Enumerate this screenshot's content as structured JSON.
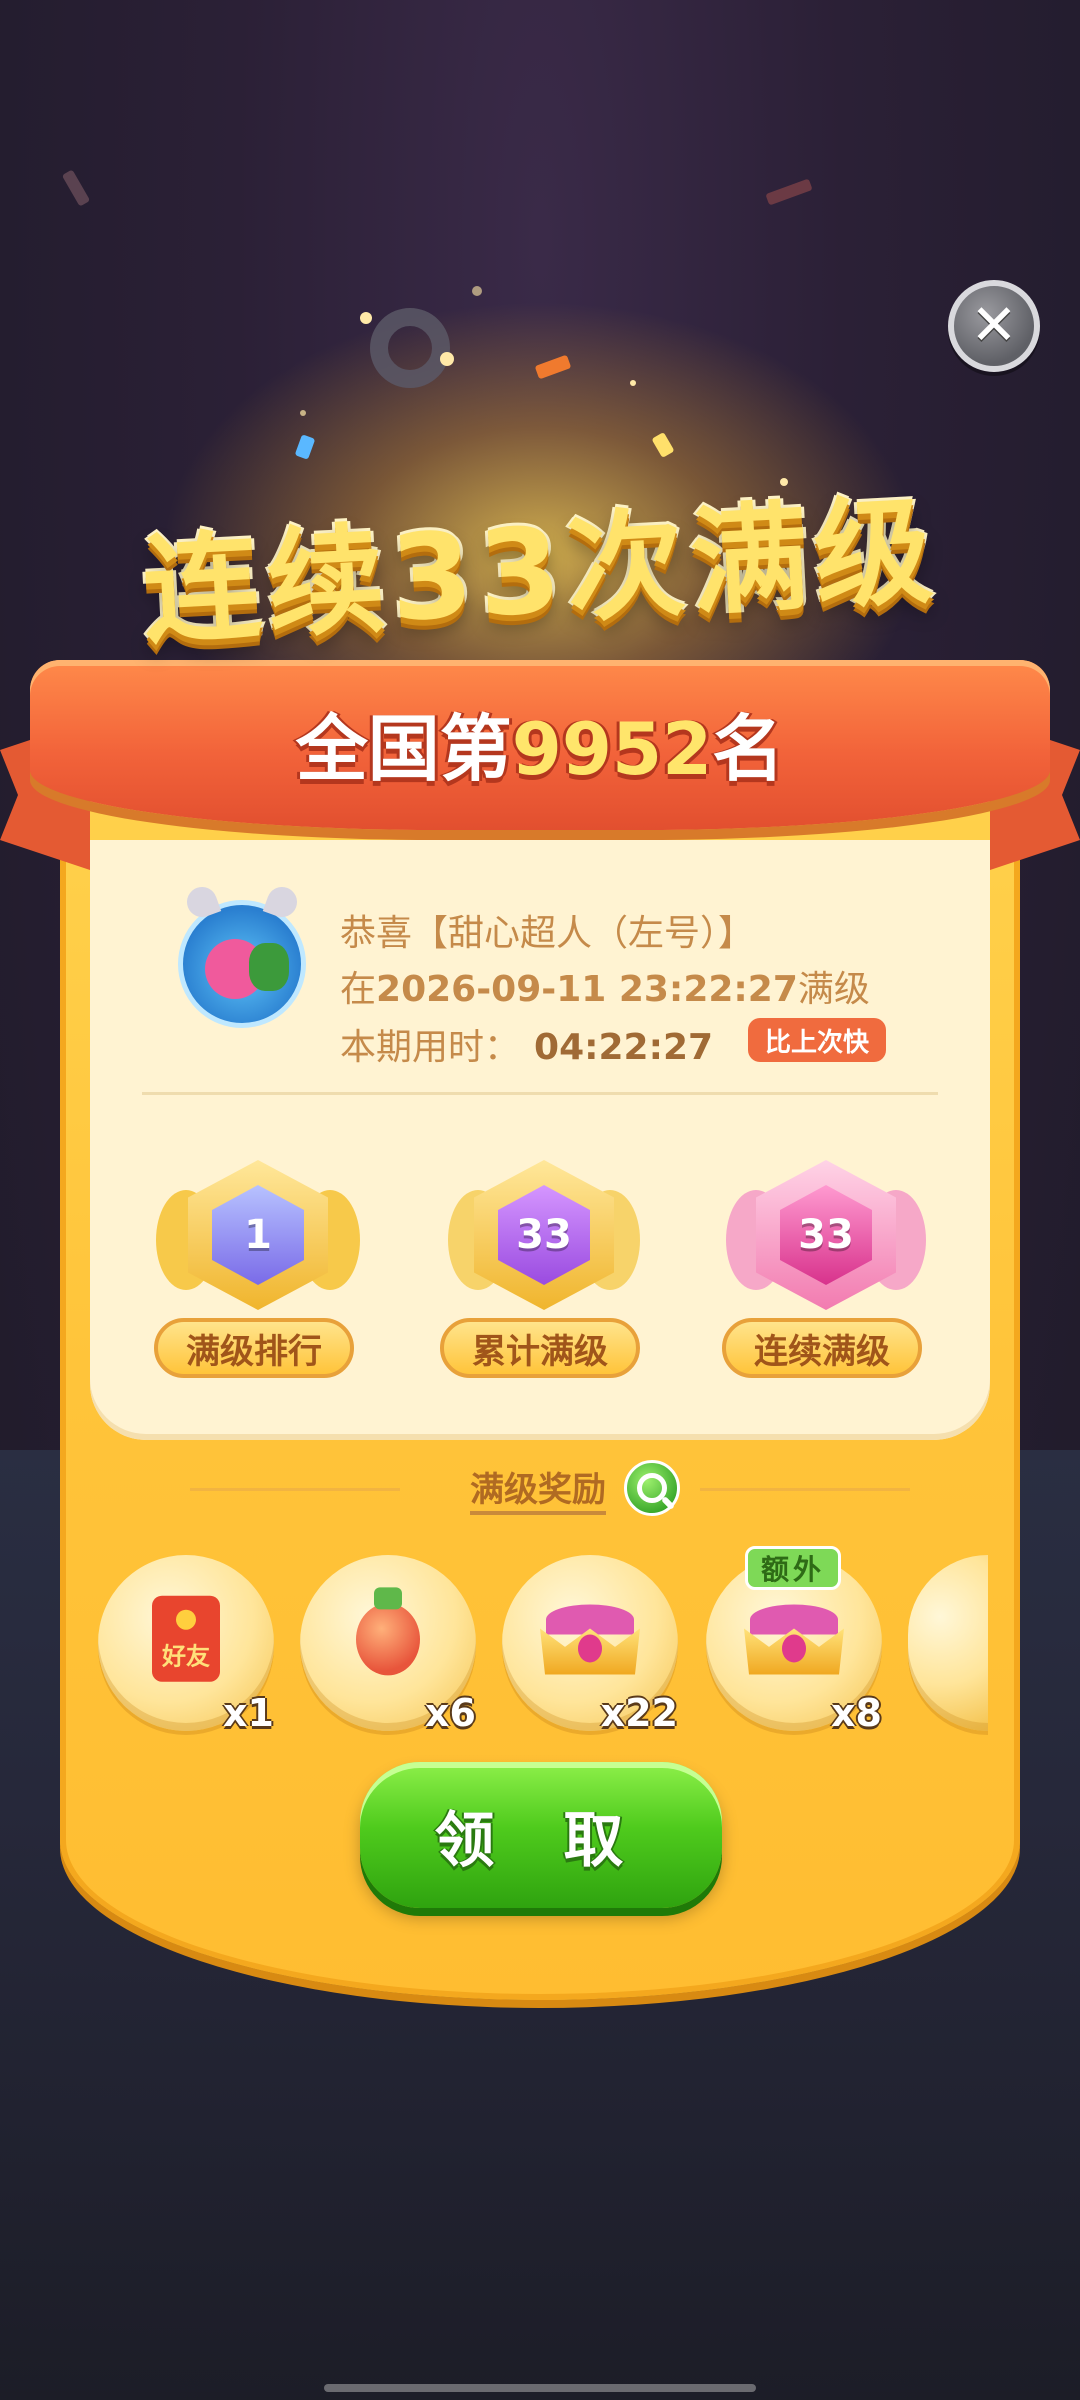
{
  "dialog": {
    "headline": "连续33次满级",
    "rank": {
      "prefix": "全国第",
      "number": "9952",
      "suffix": "名"
    },
    "close_icon": "close-icon"
  },
  "player_info": {
    "line1": "恭喜【甜心超人（左号）】",
    "line2_prefix": "在",
    "line2_datetime": "2026-09-11 23:22:27",
    "line2_suffix": "满级",
    "line3_label": "本期用时：",
    "line3_time": "04:22:27",
    "faster_badge": "比上次快"
  },
  "badges": [
    {
      "label": "满级排行",
      "value": "1"
    },
    {
      "label": "累计满级",
      "value": "33"
    },
    {
      "label": "连续满级",
      "value": "33"
    }
  ],
  "rewards": {
    "title": "满级奖励",
    "items": [
      {
        "icon": "red-envelope-icon",
        "text": "好友",
        "count": "x1"
      },
      {
        "icon": "potion-icon",
        "count": "x6"
      },
      {
        "icon": "crown-icon",
        "count": "x22"
      },
      {
        "icon": "crown-icon",
        "count": "x8",
        "tag": "额外"
      }
    ]
  },
  "claim_button": "领 取",
  "colors": {
    "panel": "#ffc43a",
    "ribbon": "#f2633a",
    "button": "#4fcb1d",
    "headline": "#ffe36b"
  }
}
